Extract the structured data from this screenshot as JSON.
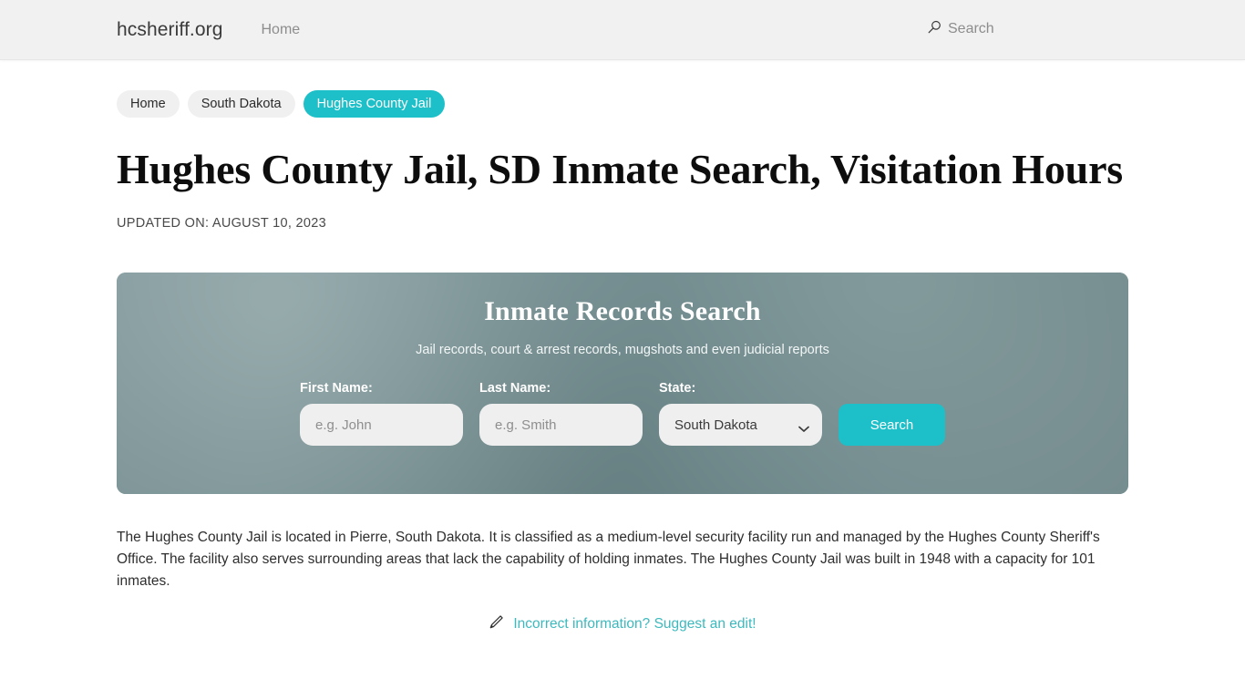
{
  "header": {
    "brand": "hcsheriff.org",
    "nav": [
      {
        "label": "Home"
      }
    ],
    "search_label": "Search",
    "search_icon": "search-icon"
  },
  "breadcrumb": {
    "items": [
      {
        "label": "Home",
        "active": false
      },
      {
        "label": "South Dakota",
        "active": false
      },
      {
        "label": "Hughes County Jail",
        "active": true
      }
    ]
  },
  "article": {
    "title": "Hughes County Jail, SD Inmate Search, Visitation Hours",
    "updated": "UPDATED ON: AUGUST 10, 2023",
    "body": "The Hughes County Jail is located in Pierre, South Dakota. It is classified as a medium-level security facility run and managed by the Hughes County Sheriff's Office. The facility also serves surrounding areas that lack the capability of holding inmates. The Hughes County Jail was built in 1948 with a capacity for 101 inmates.",
    "edit_link": "Incorrect information? Suggest an edit!",
    "edit_icon": "pencil-icon"
  },
  "search_panel": {
    "title": "Inmate Records Search",
    "subtitle": "Jail records, court & arrest records, mugshots and even judicial reports",
    "first_name": {
      "label": "First Name:",
      "value": "",
      "placeholder": "e.g. John"
    },
    "last_name": {
      "label": "Last Name:",
      "value": "",
      "placeholder": "e.g. Smith"
    },
    "state": {
      "label": "State:",
      "selected": "South Dakota",
      "options": [
        "South Dakota"
      ]
    },
    "submit_label": "Search"
  },
  "colors": {
    "accent_teal": "#1dbfc8",
    "link_teal": "#3db9bd",
    "header_bg": "#f1f1f1",
    "pill_bg": "#f0f0f0",
    "panel_bg": "#738e91",
    "input_bg": "#efefef"
  }
}
